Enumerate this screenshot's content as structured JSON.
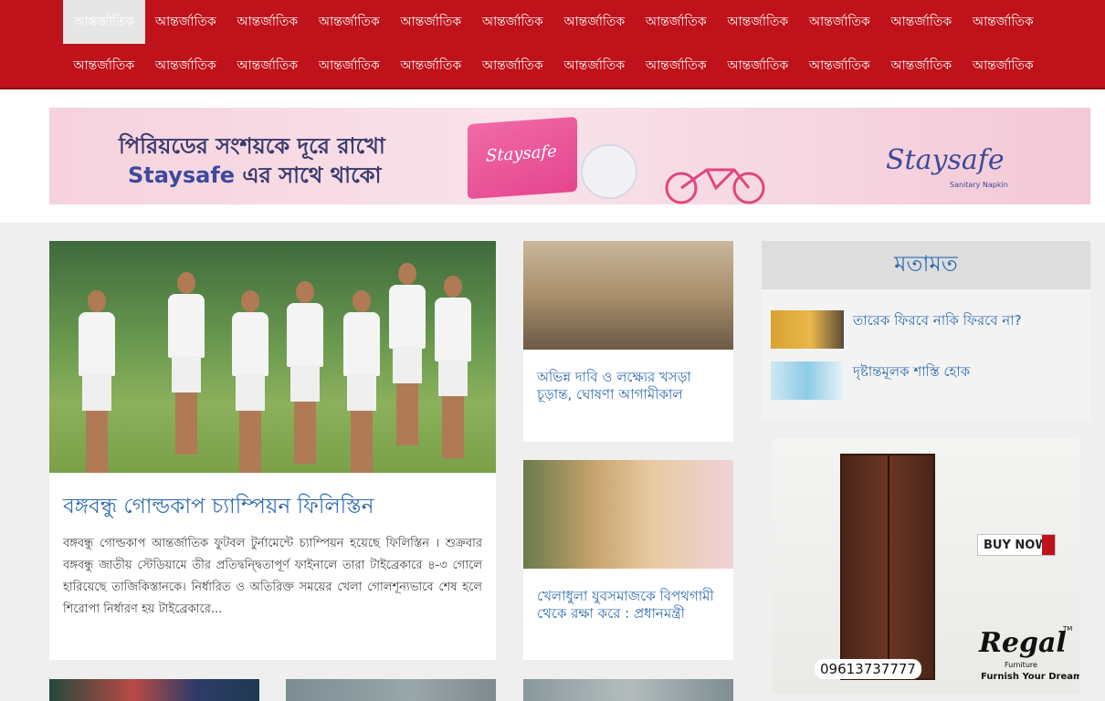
{
  "nav": {
    "row1": [
      "আন্তর্জাতিক",
      "আন্তর্জাতিক",
      "আন্তর্জাতিক",
      "আন্তর্জাতিক",
      "আন্তর্জাতিক",
      "আন্তর্জাতিক",
      "আন্তর্জাতিক",
      "আন্তর্জাতিক",
      "আন্তর্জাতিক",
      "আন্তর্জাতিক",
      "আন্তর্জাতিক",
      "আন্তর্জাতিক"
    ],
    "row2": [
      "আন্তর্জাতিক",
      "আন্তর্জাতিক",
      "আন্তর্জাতিক",
      "আন্তর্জাতিক",
      "আন্তর্জাতিক",
      "আন্তর্জাতিক",
      "আন্তর্জাতিক",
      "আন্তর্জাতিক",
      "আন্তর্জাতিক",
      "আন্তর্জাতিক",
      "আন্তর্জাতিক",
      "আন্তর্জাতিক"
    ],
    "active_index": 0
  },
  "banner_ad": {
    "line1": "পিরিয়ডের সংশয়কে দূরে রাখো",
    "line2_brand": "Staysafe",
    "line2_rest": " এর সাথে থাকো",
    "pack_label": "Staysafe",
    "logo": "Staysafe",
    "logo_sub": "Sanitary Napkin"
  },
  "lead_story": {
    "title": "বঙ্গবন্ধু গোল্ডকাপ চ্যাম্পিয়ন ফিলিস্তিন",
    "summary": "বঙ্গবন্ধু গোল্ডকাপ আন্তর্জাতিক ফুটবল টুর্নামেন্টে চ্যাম্পিয়ন হয়েছে ফিলিস্তিন । শুক্রবার বঙ্গবন্ধু জাতীয় স্টেডিয়ামে তীর প্রতিদ্বন্দ্বিতাপূর্ণ ফাইনালে তারা টাইব্রেকারে ৪-৩ গোলে হারিয়েছে তাজিকিস্তানকে। নির্ধারিত ও অতিরিক্ত সময়ের খেলা গোলশূন্যভাবে শেষ হলে শিরোপা নির্ধারণ হয় টাইব্রেকারে..."
  },
  "side_stories": [
    {
      "title": "অভিন্ন দাবি ও লক্ষ্যের খসড়া চূড়ান্ত, ঘোষণা আগামীকাল"
    },
    {
      "title": "খেলাধুলা যুবসমাজকে বিপথগামী থেকে রক্ষা করে : প্রধানমন্ত্রী"
    }
  ],
  "opinion": {
    "heading": "মতামত",
    "items": [
      {
        "title": "তারেক ফিরবে নাকি ফিরবে না?"
      },
      {
        "title": "দৃষ্টান্তমূলক শাস্তি হোক"
      }
    ]
  },
  "regal_ad": {
    "buy_label": "BUY NOW",
    "phone": "09613737777",
    "logo": "Regal",
    "logo_sub": "Furniture",
    "tagline": "Furnish Your Dream",
    "tm": "TM"
  },
  "colors": {
    "nav_bg": "#c0121a",
    "link": "#2e6bb0",
    "page_bg": "#efefef"
  }
}
